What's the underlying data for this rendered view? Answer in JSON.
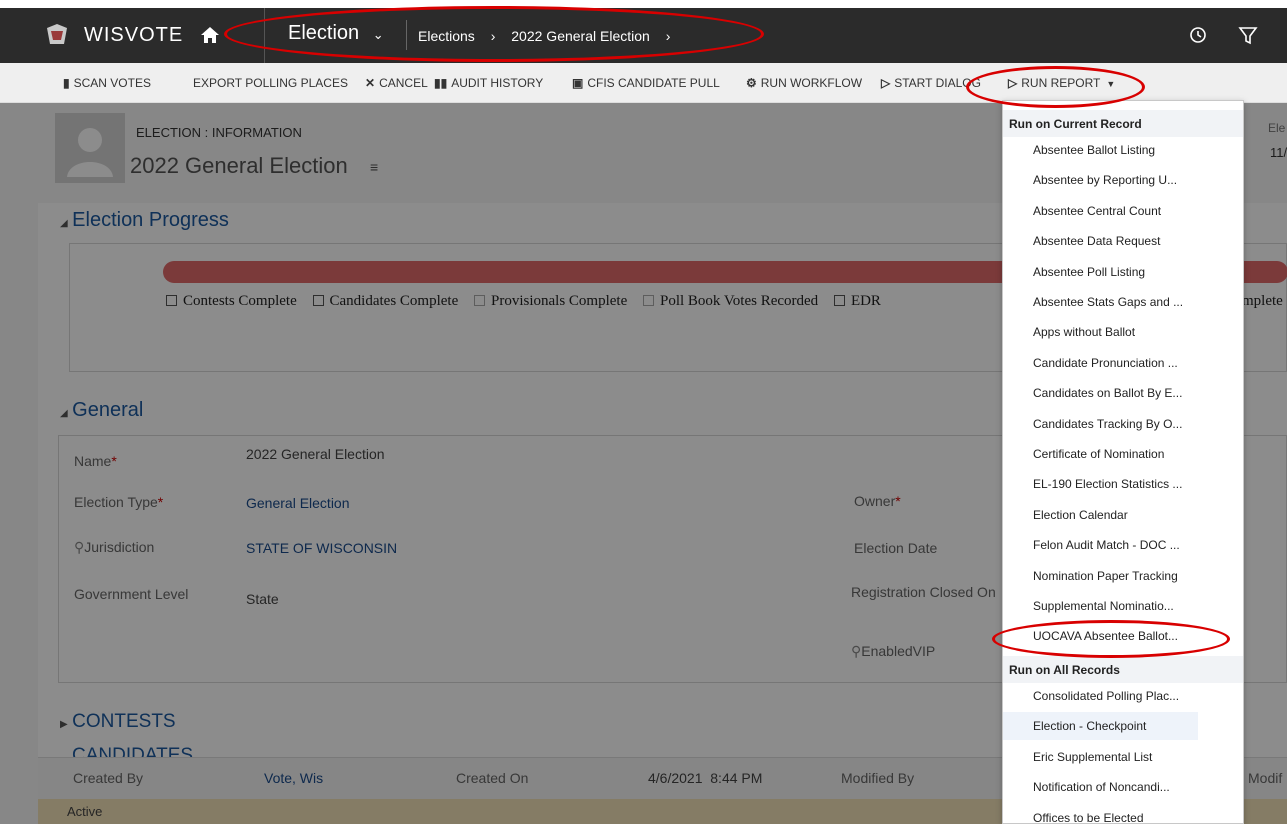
{
  "topbar": {
    "app_name": "WISVOTE",
    "entity": "Election",
    "breadcrumb": [
      "Elections",
      "2022 General Election"
    ]
  },
  "commands": [
    {
      "label": "SCAN VOTES",
      "icon": "scan-icon"
    },
    {
      "label": "EXPORT POLLING PLACES",
      "icon": ""
    },
    {
      "label": "CANCEL",
      "icon": "close-icon"
    },
    {
      "label": "AUDIT HISTORY",
      "icon": "books-icon"
    },
    {
      "label": "CFIS CANDIDATE PULL",
      "icon": "cart-icon"
    },
    {
      "label": "RUN WORKFLOW",
      "icon": "workflow-icon"
    },
    {
      "label": "START DIALOG",
      "icon": "dialog-icon"
    },
    {
      "label": "RUN REPORT",
      "icon": "report-icon"
    }
  ],
  "header": {
    "form_name": "ELECTION : INFORMATION",
    "record_title": "2022 General Election",
    "right_label": "Ele",
    "right_value": "11/"
  },
  "progress": {
    "title": "Election Progress",
    "checks": [
      "Contests Complete",
      "Candidates Complete",
      "Provisionals Complete",
      "Poll Book Votes Recorded",
      "EDR"
    ],
    "trailing": "mplete"
  },
  "general": {
    "title": "General",
    "name_label": "Name",
    "name_value": "2022 General Election",
    "type_label": "Election Type",
    "type_value": "General Election",
    "jur_label": "Jurisdiction",
    "jur_value": "STATE OF WISCONSIN",
    "gov_label": "Government Level",
    "gov_value": "State",
    "owner_label": "Owner",
    "date_label": "Election Date",
    "reg_label": "Registration Closed On",
    "vip_label": "EnabledVIP"
  },
  "contests": {
    "title": "CONTESTS",
    "next": "CANDIDATES"
  },
  "footer": {
    "created_by_label": "Created By",
    "created_by_value": "Vote, Wis",
    "created_on_label": "Created On",
    "created_on_value": "4/6/2021  8:44 PM",
    "modified_by_label": "Modified By",
    "modified_on_label": "Modif",
    "status": "Active"
  },
  "report_menu": {
    "current_header": "Run on Current Record",
    "current_items": [
      "Absentee Ballot Listing",
      "Absentee by Reporting U...",
      "Absentee Central Count",
      "Absentee Data Request",
      "Absentee Poll Listing",
      "Absentee Stats Gaps and ...",
      "Apps without Ballot",
      "Candidate Pronunciation ...",
      "Candidates on Ballot By E...",
      "Candidates Tracking By O...",
      "Certificate of Nomination",
      "EL-190 Election Statistics ...",
      "Election Calendar",
      "Felon Audit Match - DOC ...",
      "Nomination Paper Tracking",
      "Supplemental Nominatio...",
      "UOCAVA Absentee Ballot..."
    ],
    "all_header": "Run on All Records",
    "all_items": [
      "Consolidated Polling Plac...",
      "Election - Checkpoint",
      "Eric Supplemental List",
      "Notification of Noncandi...",
      "Offices to be Elected"
    ]
  },
  "colors": {
    "highlight_ring": "#d80000",
    "topbar": "#2b2b2b",
    "link": "#1a4b8c"
  }
}
